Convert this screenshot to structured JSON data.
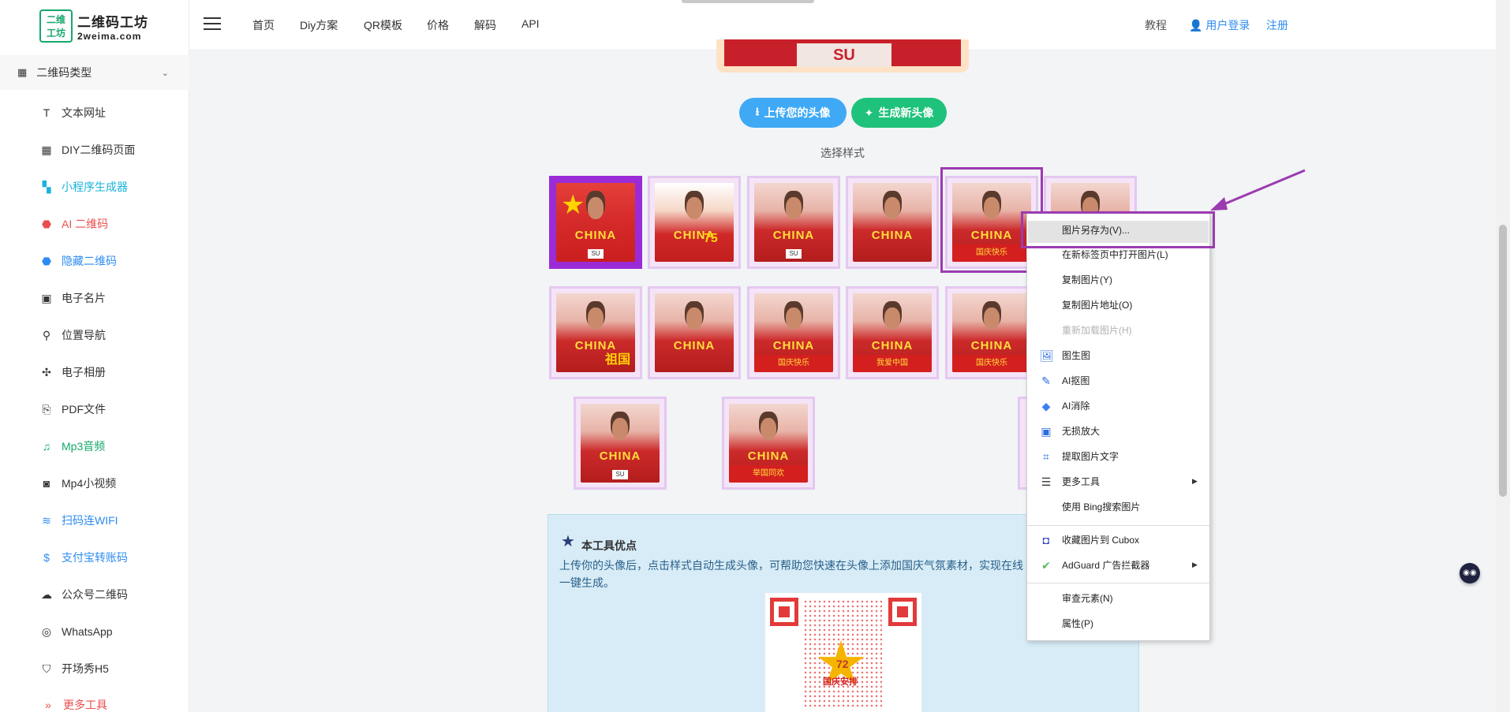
{
  "logo": {
    "mark": "二维\n工坊",
    "title": "二维码工坊",
    "domain": "2weima.com"
  },
  "sidebar": {
    "section": {
      "label": "二维码类型",
      "icon": "qr-grid-icon"
    },
    "items": [
      {
        "label": "文本网址",
        "icon": "text-t-icon",
        "color": "#333333"
      },
      {
        "label": "DIY二维码页面",
        "icon": "layout-icon",
        "color": "#333333"
      },
      {
        "label": "小程序生成器",
        "icon": "miniapp-icon",
        "color": "#19b3d9"
      },
      {
        "label": "AI 二维码",
        "icon": "ai-badge-icon",
        "color": "#e94e4e"
      },
      {
        "label": "隐藏二维码",
        "icon": "hidden-badge-icon",
        "color": "#2d8cf0"
      },
      {
        "label": "电子名片",
        "icon": "id-card-icon",
        "color": "#333333"
      },
      {
        "label": "位置导航",
        "icon": "location-pin-icon",
        "color": "#333333"
      },
      {
        "label": "电子相册",
        "icon": "pinwheel-icon",
        "color": "#333333"
      },
      {
        "label": "PDF文件",
        "icon": "pdf-icon",
        "color": "#333333"
      },
      {
        "label": "Mp3音频",
        "icon": "music-note-icon",
        "color": "#16a86b"
      },
      {
        "label": "Mp4小视频",
        "icon": "camera-icon",
        "color": "#333333"
      },
      {
        "label": "扫码连WIFI",
        "icon": "wifi-icon",
        "color": "#2d8cf0"
      },
      {
        "label": "支付宝转账码",
        "icon": "dollar-badge-icon",
        "color": "#2d8cf0"
      },
      {
        "label": "公众号二维码",
        "icon": "wechat-icon",
        "color": "#333333"
      },
      {
        "label": "WhatsApp",
        "icon": "whatsapp-icon",
        "color": "#333333"
      },
      {
        "label": "开场秀H5",
        "icon": "html5-icon",
        "color": "#333333"
      },
      {
        "label": "更多工具",
        "icon": "more-arrow-icon",
        "color": "#e94e4e"
      }
    ]
  },
  "topbar": {
    "nav": [
      "首页",
      "Diy方案",
      "QR模板",
      "价格",
      "解码",
      "API"
    ],
    "tutorial": "教程",
    "login": "用户登录",
    "register": "注册"
  },
  "preview": {
    "text": "SU"
  },
  "buttons": {
    "upload": "上传您的头像",
    "generate": "生成新头像"
  },
  "style_label": "选择样式",
  "thumbs": [
    {
      "text": "CHINA",
      "bib": "SU",
      "deco": "★",
      "ribbon": ""
    },
    {
      "text": "CHINA",
      "bib": "",
      "deco": "75",
      "ribbon": ""
    },
    {
      "text": "CHINA",
      "bib": "SU",
      "deco": "",
      "ribbon": ""
    },
    {
      "text": "CHINA",
      "bib": "",
      "deco": "",
      "ribbon": ""
    },
    {
      "text": "CHINA",
      "bib": "",
      "deco": "",
      "ribbon": "国庆快乐"
    },
    {
      "text": "",
      "bib": "",
      "deco": "",
      "ribbon": ""
    },
    {
      "text": "CHINA",
      "bib": "",
      "deco": "祖国",
      "ribbon": ""
    },
    {
      "text": "CHINA",
      "bib": "",
      "deco": "",
      "ribbon": ""
    },
    {
      "text": "CHINA",
      "bib": "",
      "deco": "",
      "ribbon": "国庆快乐"
    },
    {
      "text": "CHINA",
      "bib": "",
      "deco": "",
      "ribbon": "我爱中国"
    },
    {
      "text": "CHINA",
      "bib": "",
      "deco": "",
      "ribbon": "国庆快乐"
    },
    {
      "text": "",
      "bib": "",
      "deco": "",
      "ribbon": ""
    },
    {
      "text": "CHINA",
      "bib": "SU",
      "deco": "",
      "ribbon": ""
    },
    {
      "text": "CHINA",
      "bib": "",
      "deco": "",
      "ribbon": "举国同欢"
    }
  ],
  "info": {
    "title": "本工具优点",
    "text": "上传你的头像后，点击样式自动生成头像，可帮助您快速在头像上添加国庆气氛素材，实现在线一键生成。",
    "qr_number": "72",
    "qr_caption": "国庆安排"
  },
  "context_menu": {
    "items": [
      {
        "label": "图片另存为(V)...",
        "icon": "",
        "disabled": false,
        "submenu": false
      },
      {
        "label": "在新标签页中打开图片(L)",
        "icon": "",
        "disabled": false,
        "submenu": false
      },
      {
        "label": "复制图片(Y)",
        "icon": "",
        "disabled": false,
        "submenu": false
      },
      {
        "label": "复制图片地址(O)",
        "icon": "",
        "disabled": false,
        "submenu": false
      },
      {
        "label": "重新加载图片(H)",
        "icon": "",
        "disabled": true,
        "submenu": false
      },
      {
        "label": "图生图",
        "icon": "image-icon",
        "disabled": false,
        "submenu": false
      },
      {
        "label": "AI抠图",
        "icon": "magic-wand-icon",
        "disabled": false,
        "submenu": false
      },
      {
        "label": "AI消除",
        "icon": "eraser-icon",
        "disabled": false,
        "submenu": false
      },
      {
        "label": "无损放大",
        "icon": "hd-icon",
        "disabled": false,
        "submenu": false
      },
      {
        "label": "提取图片文字",
        "icon": "text-scan-icon",
        "disabled": false,
        "submenu": false
      },
      {
        "label": "更多工具",
        "icon": "menu-lines-icon",
        "disabled": false,
        "submenu": true
      },
      {
        "label": "使用 Bing搜索图片",
        "icon": "",
        "disabled": false,
        "submenu": false
      },
      {
        "label": "收藏图片到 Cubox",
        "icon": "cubox-icon",
        "disabled": false,
        "submenu": false
      },
      {
        "label": "AdGuard 广告拦截器",
        "icon": "adguard-shield-icon",
        "disabled": false,
        "submenu": true
      },
      {
        "label": "审查元素(N)",
        "icon": "",
        "disabled": false,
        "submenu": false
      },
      {
        "label": "属性(P)",
        "icon": "",
        "disabled": false,
        "submenu": false
      }
    ]
  },
  "colors": {
    "accent_purple": "#9b3bb0",
    "brand_green": "#16a86b",
    "link_blue": "#2d8cf0"
  }
}
